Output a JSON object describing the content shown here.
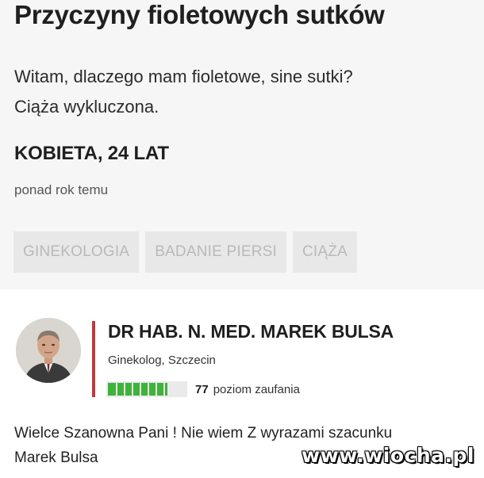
{
  "question": {
    "title": "Przyczyny fioletowych sutków",
    "body_lines": [
      "Witam, dlaczego mam fioletowe, sine sutki?",
      "Ciąża wykluczona."
    ],
    "author": "KOBIETA, 24 LAT",
    "time": "ponad rok temu",
    "tags": [
      "GINEKOLOGIA",
      "BADANIE PIERSI",
      "CIĄŻA"
    ]
  },
  "answer": {
    "doctor_name": "DR HAB. N. MED. MAREK BULSA",
    "specialty": "Ginekolog, Szczecin",
    "trust_score": "77",
    "trust_label": "poziom zaufania",
    "trust_level": 0.77,
    "reply_lines": [
      "Wielce Szanowna Pani ! Nie wiem Z wyrazami szacunku",
      "Marek Bulsa"
    ]
  },
  "watermark": "www.wiocha.pl",
  "colors": {
    "accent_red": "#c0393b",
    "trust_green": "#3fb23a",
    "tag_bg": "#e8e8e8",
    "tag_text": "#b9b9b9"
  }
}
